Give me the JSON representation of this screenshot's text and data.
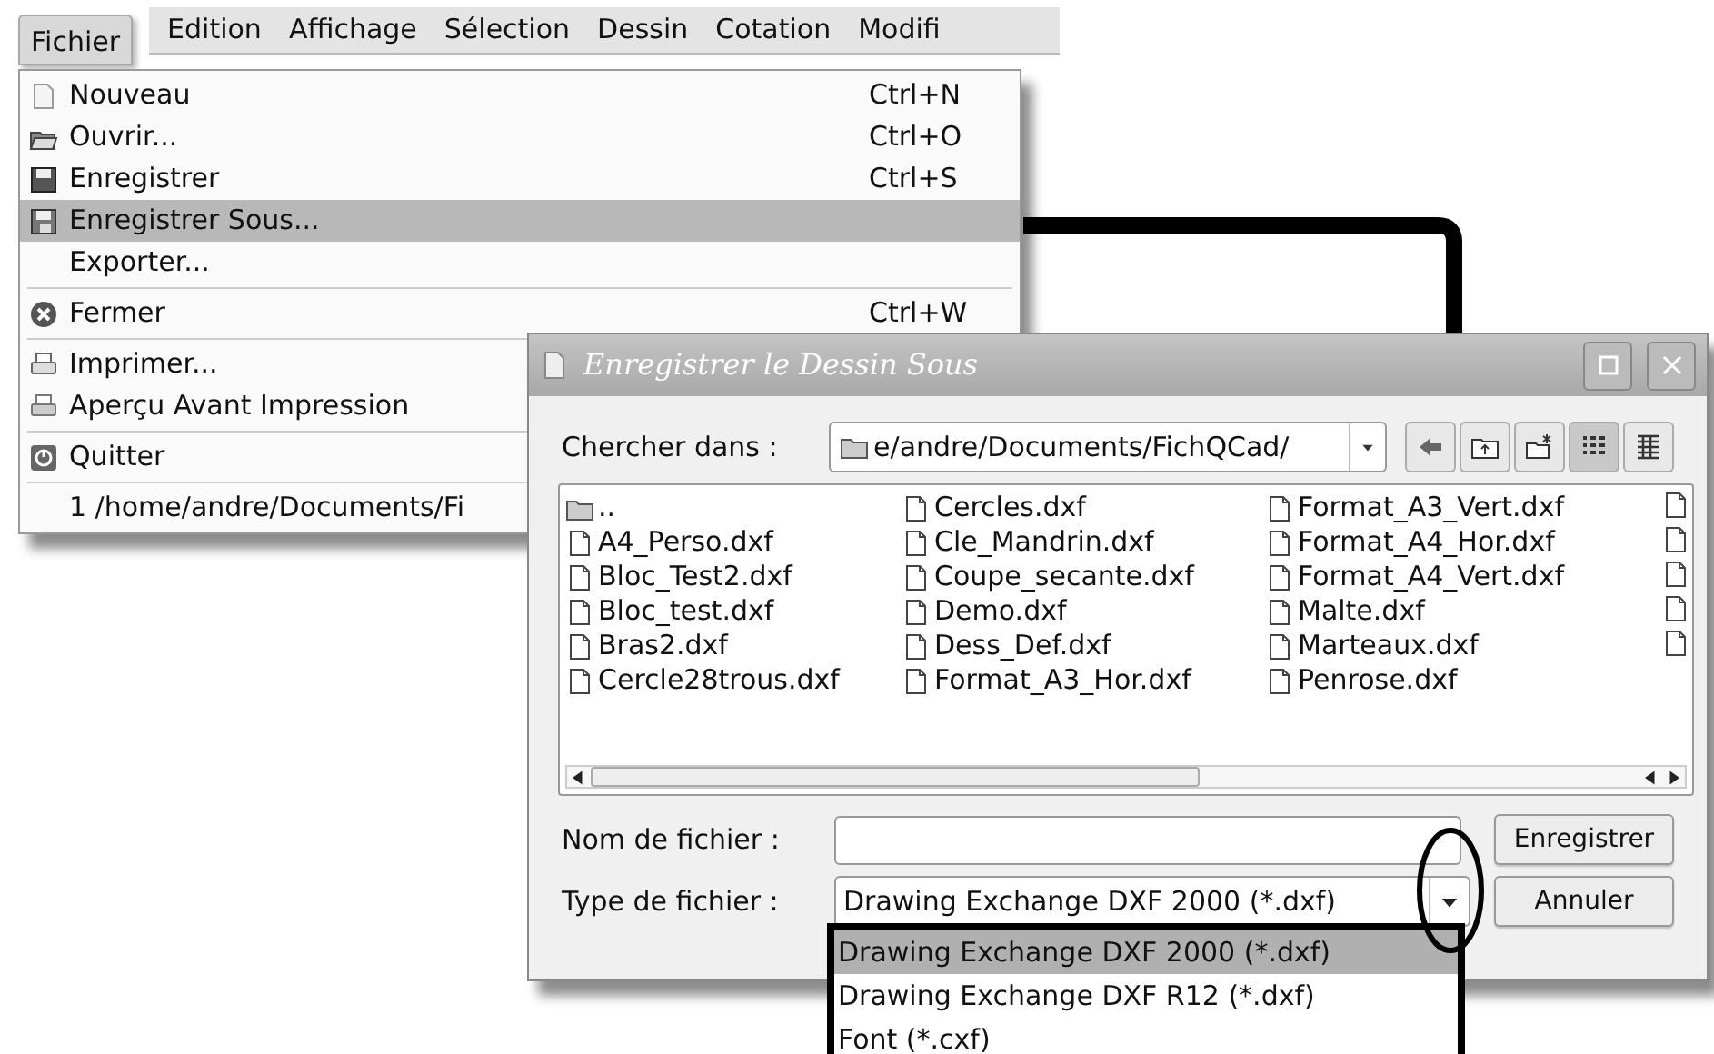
{
  "menubar": {
    "menus": [
      {
        "label": "Fichier",
        "selected": true
      },
      {
        "label": "Edition",
        "selected": false
      },
      {
        "label": "Affichage",
        "selected": false
      },
      {
        "label": "Sélection",
        "selected": false
      },
      {
        "label": "Dessin",
        "selected": false
      },
      {
        "label": "Cotation",
        "selected": false
      },
      {
        "label": "Modifi",
        "selected": false
      }
    ]
  },
  "file_menu": {
    "items": [
      {
        "kind": "item",
        "label": "Nouveau",
        "shortcut": "Ctrl+N",
        "selected": false
      },
      {
        "kind": "item",
        "label": "Ouvrir...",
        "shortcut": "Ctrl+O",
        "selected": false
      },
      {
        "kind": "item",
        "label": "Enregistrer",
        "shortcut": "Ctrl+S",
        "selected": false
      },
      {
        "kind": "item",
        "label": "Enregistrer Sous...",
        "selected": true
      },
      {
        "kind": "item",
        "label": "Exporter...",
        "selected": false
      },
      {
        "kind": "separator"
      },
      {
        "kind": "item",
        "label": "Fermer",
        "shortcut": "Ctrl+W",
        "selected": false
      },
      {
        "kind": "separator"
      },
      {
        "kind": "item",
        "label": "Imprimer...",
        "selected": false
      },
      {
        "kind": "item",
        "label": "Aperçu Avant Impression",
        "selected": false
      },
      {
        "kind": "separator"
      },
      {
        "kind": "item",
        "label": "Quitter",
        "selected": false
      },
      {
        "kind": "separator"
      },
      {
        "kind": "item",
        "label": "1 /home/andre/Documents/Fi",
        "selected": false
      }
    ]
  },
  "dialog": {
    "title": "Enregistrer le Dessin Sous",
    "look_in": {
      "label": "Chercher dans :",
      "value": "e/andre/Documents/FichQCad/"
    },
    "view_buttons": [
      {
        "kind": "list",
        "selected": true
      },
      {
        "kind": "detail",
        "selected": false
      }
    ],
    "files": [
      {
        "kind": "folder",
        "name": ".."
      },
      {
        "kind": "file",
        "name": "A4_Perso.dxf"
      },
      {
        "kind": "file",
        "name": "Bloc_Test2.dxf"
      },
      {
        "kind": "file",
        "name": "Bloc_test.dxf"
      },
      {
        "kind": "file",
        "name": "Bras2.dxf"
      },
      {
        "kind": "file",
        "name": "Cercle28trous.dxf"
      },
      {
        "kind": "file",
        "name": "Cercles.dxf"
      },
      {
        "kind": "file",
        "name": "Cle_Mandrin.dxf"
      },
      {
        "kind": "file",
        "name": "Coupe_secante.dxf"
      },
      {
        "kind": "file",
        "name": "Demo.dxf"
      },
      {
        "kind": "file",
        "name": "Dess_Def.dxf"
      },
      {
        "kind": "file",
        "name": "Format_A3_Hor.dxf"
      },
      {
        "kind": "file",
        "name": "Format_A3_Vert.dxf"
      },
      {
        "kind": "file",
        "name": "Format_A4_Hor.dxf"
      },
      {
        "kind": "file",
        "name": "Format_A4_Vert.dxf"
      },
      {
        "kind": "file",
        "name": "Malte.dxf"
      },
      {
        "kind": "file",
        "name": "Marteaux.dxf"
      },
      {
        "kind": "file",
        "name": "Penrose.dxf"
      }
    ],
    "file_name": {
      "label": "Nom de fichier :"
    },
    "file_type": {
      "label": "Type de fichier :",
      "value": "Drawing Exchange DXF 2000 (*.dxf)",
      "options": [
        {
          "label": "Drawing Exchange DXF 2000 (*.dxf)",
          "selected": true
        },
        {
          "label": "Drawing Exchange DXF R12 (*.dxf)",
          "selected": false
        },
        {
          "label": "Font (*.cxf)",
          "selected": false
        }
      ]
    },
    "buttons": [
      {
        "label": "Enregistrer"
      },
      {
        "label": "Annuler"
      }
    ]
  }
}
